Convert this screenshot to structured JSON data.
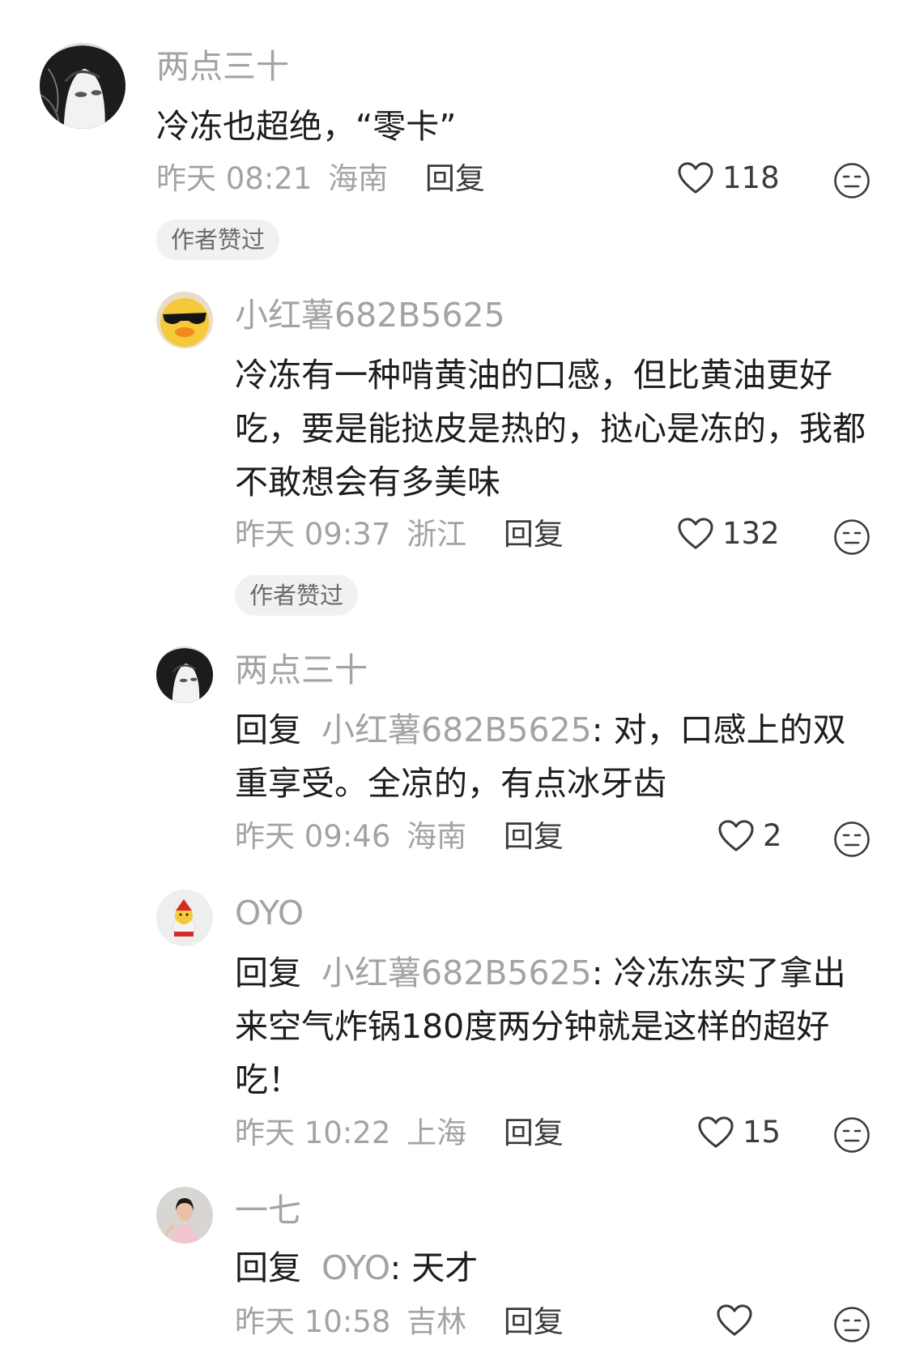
{
  "comments": [
    {
      "name": "两点三十",
      "text": "冷冻也超绝，“零卡”",
      "time": "昨天 08:21",
      "location": "海南",
      "reply_label": "回复",
      "likes": "118",
      "badge": "作者赞过"
    },
    {
      "name": "小红薯682B5625",
      "text": "冷冻有一种啃黄油的口感，但比黄油更好吃，要是能挞皮是热的，挞心是冻的，我都不敢想会有多美味",
      "time": "昨天 09:37",
      "location": "浙江",
      "reply_label": "回复",
      "likes": "132",
      "badge": "作者赞过"
    },
    {
      "name": "两点三十",
      "reply_prefix": "回复",
      "reply_to": "小红薯682B5625",
      "colon": ": ",
      "text": "对，口感上的双重享受。全凉的，有点冰牙齿",
      "time": "昨天 09:46",
      "location": "海南",
      "reply_label": "回复",
      "likes": "2"
    },
    {
      "name": "OYO",
      "reply_prefix": "回复",
      "reply_to": "小红薯682B5625",
      "colon": ": ",
      "text": "冷冻冻实了拿出来空气炸锅180度两分钟就是这样的超好吃！",
      "time": "昨天 10:22",
      "location": "上海",
      "reply_label": "回复",
      "likes": "15"
    },
    {
      "name": "一七",
      "reply_prefix": "回复",
      "reply_to": "OYO",
      "colon": ": ",
      "text": "天才",
      "time": "昨天 10:58",
      "location": "吉林",
      "reply_label": "回复",
      "likes": ""
    }
  ],
  "icons": {
    "like": "heart-outline-icon",
    "dislike": "meh-face-icon"
  },
  "colors": {
    "muted": "#a3a3a3",
    "text": "#1d1d1d",
    "badge_bg": "#f1f1f1"
  }
}
